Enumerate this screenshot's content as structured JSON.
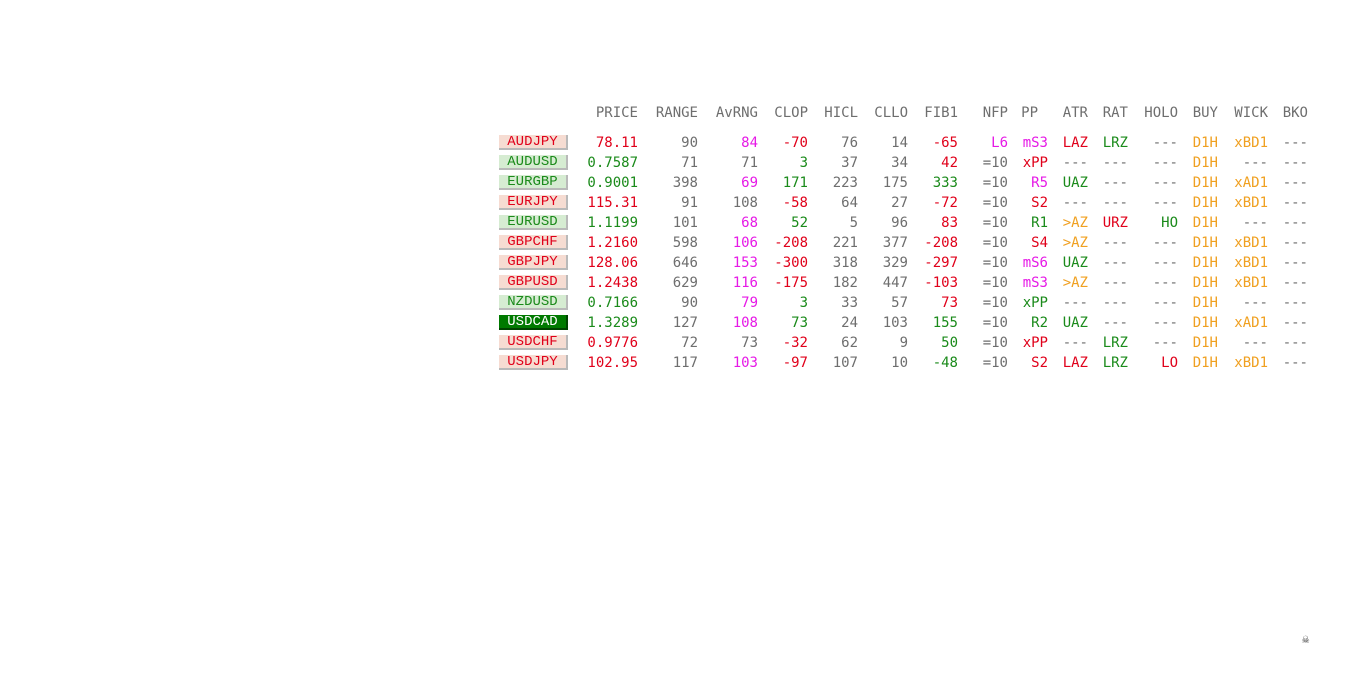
{
  "colors": {
    "header": "#6e6e6e",
    "red": "#e0001a",
    "green": "#1a8a1a",
    "magenta": "#e619e6",
    "gray": "#6e6e6e",
    "orange": "#f0a020",
    "symbol_down_bg": "#f6dcd2",
    "symbol_up_bg": "#d6ecd2",
    "symbol_selected_bg": "#007a00"
  },
  "icons": {
    "corner": "skull-crossbones-icon"
  },
  "headers": [
    "PRICE",
    "RANGE",
    "AvRNG",
    "CLOP",
    "HICL",
    "CLLO",
    "FIB1",
    "NFP",
    "PP",
    "ATR",
    "RAT",
    "HOLO",
    "BUY",
    "WICK",
    "BKO"
  ],
  "rows": [
    {
      "symbol": "AUDJPY",
      "state": "down",
      "cells": [
        {
          "t": "78.11",
          "c": "red"
        },
        {
          "t": "90",
          "c": "gray"
        },
        {
          "t": "84",
          "c": "magenta"
        },
        {
          "t": "-70",
          "c": "red"
        },
        {
          "t": "76",
          "c": "gray"
        },
        {
          "t": "14",
          "c": "gray"
        },
        {
          "t": "-65",
          "c": "red"
        },
        {
          "t": "L6",
          "c": "magenta"
        },
        {
          "t": "mS3",
          "c": "magenta"
        },
        {
          "t": "LAZ",
          "c": "red"
        },
        {
          "t": "LRZ",
          "c": "green"
        },
        {
          "t": "---",
          "c": "gray"
        },
        {
          "t": "D1H",
          "c": "orange"
        },
        {
          "t": "xBD1",
          "c": "orange"
        },
        {
          "t": "---",
          "c": "gray"
        }
      ]
    },
    {
      "symbol": "AUDUSD",
      "state": "up",
      "cells": [
        {
          "t": "0.7587",
          "c": "green"
        },
        {
          "t": "71",
          "c": "gray"
        },
        {
          "t": "71",
          "c": "gray"
        },
        {
          "t": "3",
          "c": "green"
        },
        {
          "t": "37",
          "c": "gray"
        },
        {
          "t": "34",
          "c": "gray"
        },
        {
          "t": "42",
          "c": "red"
        },
        {
          "t": "=10",
          "c": "gray"
        },
        {
          "t": "xPP",
          "c": "red"
        },
        {
          "t": "---",
          "c": "gray"
        },
        {
          "t": "---",
          "c": "gray"
        },
        {
          "t": "---",
          "c": "gray"
        },
        {
          "t": "D1H",
          "c": "orange"
        },
        {
          "t": "---",
          "c": "gray"
        },
        {
          "t": "---",
          "c": "gray"
        }
      ]
    },
    {
      "symbol": "EURGBP",
      "state": "up",
      "cells": [
        {
          "t": "0.9001",
          "c": "green"
        },
        {
          "t": "398",
          "c": "gray"
        },
        {
          "t": "69",
          "c": "magenta"
        },
        {
          "t": "171",
          "c": "green"
        },
        {
          "t": "223",
          "c": "gray"
        },
        {
          "t": "175",
          "c": "gray"
        },
        {
          "t": "333",
          "c": "green"
        },
        {
          "t": "=10",
          "c": "gray"
        },
        {
          "t": "R5",
          "c": "magenta"
        },
        {
          "t": "UAZ",
          "c": "green"
        },
        {
          "t": "---",
          "c": "gray"
        },
        {
          "t": "---",
          "c": "gray"
        },
        {
          "t": "D1H",
          "c": "orange"
        },
        {
          "t": "xAD1",
          "c": "orange"
        },
        {
          "t": "---",
          "c": "gray"
        }
      ]
    },
    {
      "symbol": "EURJPY",
      "state": "down",
      "cells": [
        {
          "t": "115.31",
          "c": "red"
        },
        {
          "t": "91",
          "c": "gray"
        },
        {
          "t": "108",
          "c": "gray"
        },
        {
          "t": "-58",
          "c": "red"
        },
        {
          "t": "64",
          "c": "gray"
        },
        {
          "t": "27",
          "c": "gray"
        },
        {
          "t": "-72",
          "c": "red"
        },
        {
          "t": "=10",
          "c": "gray"
        },
        {
          "t": "S2",
          "c": "red"
        },
        {
          "t": "---",
          "c": "gray"
        },
        {
          "t": "---",
          "c": "gray"
        },
        {
          "t": "---",
          "c": "gray"
        },
        {
          "t": "D1H",
          "c": "orange"
        },
        {
          "t": "xBD1",
          "c": "orange"
        },
        {
          "t": "---",
          "c": "gray"
        }
      ]
    },
    {
      "symbol": "EURUSD",
      "state": "up",
      "cells": [
        {
          "t": "1.1199",
          "c": "green"
        },
        {
          "t": "101",
          "c": "gray"
        },
        {
          "t": "68",
          "c": "magenta"
        },
        {
          "t": "52",
          "c": "green"
        },
        {
          "t": "5",
          "c": "gray"
        },
        {
          "t": "96",
          "c": "gray"
        },
        {
          "t": "83",
          "c": "red"
        },
        {
          "t": "=10",
          "c": "gray"
        },
        {
          "t": "R1",
          "c": "green"
        },
        {
          "t": ">AZ",
          "c": "orange"
        },
        {
          "t": "URZ",
          "c": "red"
        },
        {
          "t": "HO",
          "c": "green"
        },
        {
          "t": "D1H",
          "c": "orange"
        },
        {
          "t": "---",
          "c": "gray"
        },
        {
          "t": "---",
          "c": "gray"
        }
      ]
    },
    {
      "symbol": "GBPCHF",
      "state": "down",
      "cells": [
        {
          "t": "1.2160",
          "c": "red"
        },
        {
          "t": "598",
          "c": "gray"
        },
        {
          "t": "106",
          "c": "magenta"
        },
        {
          "t": "-208",
          "c": "red"
        },
        {
          "t": "221",
          "c": "gray"
        },
        {
          "t": "377",
          "c": "gray"
        },
        {
          "t": "-208",
          "c": "red"
        },
        {
          "t": "=10",
          "c": "gray"
        },
        {
          "t": "S4",
          "c": "red"
        },
        {
          "t": ">AZ",
          "c": "orange"
        },
        {
          "t": "---",
          "c": "gray"
        },
        {
          "t": "---",
          "c": "gray"
        },
        {
          "t": "D1H",
          "c": "orange"
        },
        {
          "t": "xBD1",
          "c": "orange"
        },
        {
          "t": "---",
          "c": "gray"
        }
      ]
    },
    {
      "symbol": "GBPJPY",
      "state": "down",
      "cells": [
        {
          "t": "128.06",
          "c": "red"
        },
        {
          "t": "646",
          "c": "gray"
        },
        {
          "t": "153",
          "c": "magenta"
        },
        {
          "t": "-300",
          "c": "red"
        },
        {
          "t": "318",
          "c": "gray"
        },
        {
          "t": "329",
          "c": "gray"
        },
        {
          "t": "-297",
          "c": "red"
        },
        {
          "t": "=10",
          "c": "gray"
        },
        {
          "t": "mS6",
          "c": "magenta"
        },
        {
          "t": "UAZ",
          "c": "green"
        },
        {
          "t": "---",
          "c": "gray"
        },
        {
          "t": "---",
          "c": "gray"
        },
        {
          "t": "D1H",
          "c": "orange"
        },
        {
          "t": "xBD1",
          "c": "orange"
        },
        {
          "t": "---",
          "c": "gray"
        }
      ]
    },
    {
      "symbol": "GBPUSD",
      "state": "down",
      "cells": [
        {
          "t": "1.2438",
          "c": "red"
        },
        {
          "t": "629",
          "c": "gray"
        },
        {
          "t": "116",
          "c": "magenta"
        },
        {
          "t": "-175",
          "c": "red"
        },
        {
          "t": "182",
          "c": "gray"
        },
        {
          "t": "447",
          "c": "gray"
        },
        {
          "t": "-103",
          "c": "red"
        },
        {
          "t": "=10",
          "c": "gray"
        },
        {
          "t": "mS3",
          "c": "magenta"
        },
        {
          "t": ">AZ",
          "c": "orange"
        },
        {
          "t": "---",
          "c": "gray"
        },
        {
          "t": "---",
          "c": "gray"
        },
        {
          "t": "D1H",
          "c": "orange"
        },
        {
          "t": "xBD1",
          "c": "orange"
        },
        {
          "t": "---",
          "c": "gray"
        }
      ]
    },
    {
      "symbol": "NZDUSD",
      "state": "up",
      "cells": [
        {
          "t": "0.7166",
          "c": "green"
        },
        {
          "t": "90",
          "c": "gray"
        },
        {
          "t": "79",
          "c": "magenta"
        },
        {
          "t": "3",
          "c": "green"
        },
        {
          "t": "33",
          "c": "gray"
        },
        {
          "t": "57",
          "c": "gray"
        },
        {
          "t": "73",
          "c": "red"
        },
        {
          "t": "=10",
          "c": "gray"
        },
        {
          "t": "xPP",
          "c": "green"
        },
        {
          "t": "---",
          "c": "gray"
        },
        {
          "t": "---",
          "c": "gray"
        },
        {
          "t": "---",
          "c": "gray"
        },
        {
          "t": "D1H",
          "c": "orange"
        },
        {
          "t": "---",
          "c": "gray"
        },
        {
          "t": "---",
          "c": "gray"
        }
      ]
    },
    {
      "symbol": "USDCAD",
      "state": "sel",
      "cells": [
        {
          "t": "1.3289",
          "c": "green"
        },
        {
          "t": "127",
          "c": "gray"
        },
        {
          "t": "108",
          "c": "magenta"
        },
        {
          "t": "73",
          "c": "green"
        },
        {
          "t": "24",
          "c": "gray"
        },
        {
          "t": "103",
          "c": "gray"
        },
        {
          "t": "155",
          "c": "green"
        },
        {
          "t": "=10",
          "c": "gray"
        },
        {
          "t": "R2",
          "c": "green"
        },
        {
          "t": "UAZ",
          "c": "green"
        },
        {
          "t": "---",
          "c": "gray"
        },
        {
          "t": "---",
          "c": "gray"
        },
        {
          "t": "D1H",
          "c": "orange"
        },
        {
          "t": "xAD1",
          "c": "orange"
        },
        {
          "t": "---",
          "c": "gray"
        }
      ]
    },
    {
      "symbol": "USDCHF",
      "state": "down",
      "cells": [
        {
          "t": "0.9776",
          "c": "red"
        },
        {
          "t": "72",
          "c": "gray"
        },
        {
          "t": "73",
          "c": "gray"
        },
        {
          "t": "-32",
          "c": "red"
        },
        {
          "t": "62",
          "c": "gray"
        },
        {
          "t": "9",
          "c": "gray"
        },
        {
          "t": "50",
          "c": "green"
        },
        {
          "t": "=10",
          "c": "gray"
        },
        {
          "t": "xPP",
          "c": "red"
        },
        {
          "t": "---",
          "c": "gray"
        },
        {
          "t": "LRZ",
          "c": "green"
        },
        {
          "t": "---",
          "c": "gray"
        },
        {
          "t": "D1H",
          "c": "orange"
        },
        {
          "t": "---",
          "c": "gray"
        },
        {
          "t": "---",
          "c": "gray"
        }
      ]
    },
    {
      "symbol": "USDJPY",
      "state": "down",
      "cells": [
        {
          "t": "102.95",
          "c": "red"
        },
        {
          "t": "117",
          "c": "gray"
        },
        {
          "t": "103",
          "c": "magenta"
        },
        {
          "t": "-97",
          "c": "red"
        },
        {
          "t": "107",
          "c": "gray"
        },
        {
          "t": "10",
          "c": "gray"
        },
        {
          "t": "-48",
          "c": "green"
        },
        {
          "t": "=10",
          "c": "gray"
        },
        {
          "t": "S2",
          "c": "red"
        },
        {
          "t": "LAZ",
          "c": "red"
        },
        {
          "t": "LRZ",
          "c": "green"
        },
        {
          "t": "LO",
          "c": "red"
        },
        {
          "t": "D1H",
          "c": "orange"
        },
        {
          "t": "xBD1",
          "c": "orange"
        },
        {
          "t": "---",
          "c": "gray"
        }
      ]
    }
  ]
}
